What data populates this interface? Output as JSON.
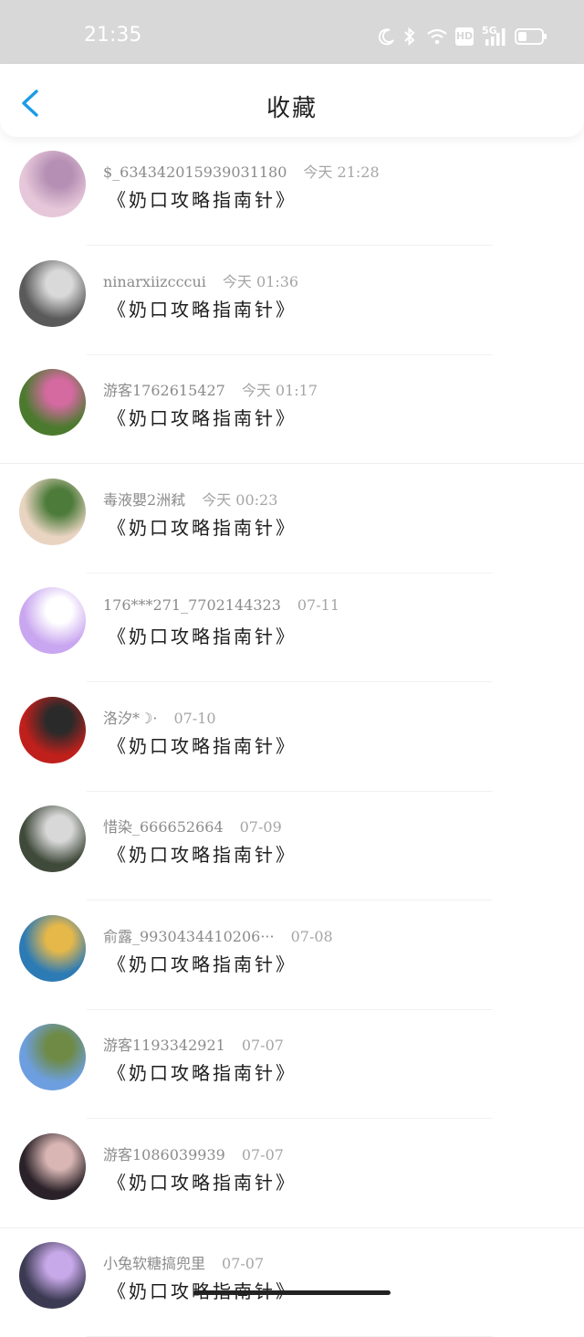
{
  "status_bar": {
    "time": "21:35",
    "badges": {
      "hd": "HD",
      "net": "5G"
    }
  },
  "header": {
    "title": "收藏",
    "back_icon": "chevron-left-icon",
    "accent": "#1a9be8"
  },
  "items": [
    {
      "user": "$_634342015939031180",
      "date": "今天 21:28",
      "title": "《奶口攻略指南针》",
      "avatar": [
        "#e6c7d9",
        "#b58fb4"
      ]
    },
    {
      "user": "ninarxiizcccui",
      "date": "今天 01:36",
      "title": "《奶口攻略指南针》",
      "avatar": [
        "#5a5a5a",
        "#d9d9d9"
      ]
    },
    {
      "user": "游客1762615427",
      "date": "今天 01:17",
      "title": "《奶口攻略指南针》",
      "avatar": [
        "#4b7a2e",
        "#d46aa0"
      ]
    },
    {
      "user": "毒液嬰2洲弒",
      "date": "今天 00:23",
      "title": "《奶口攻略指南针》",
      "avatar": [
        "#e9d4c2",
        "#4c7b3a"
      ]
    },
    {
      "user": "176***271_7702144323",
      "date": "07-11",
      "title": "《奶口攻略指南针》",
      "avatar": [
        "#c9a6f0",
        "#ffffff"
      ]
    },
    {
      "user": "洛汐*☽·",
      "date": "07-10",
      "title": "《奶口攻略指南针》",
      "avatar": [
        "#c0201c",
        "#2a2a2a"
      ]
    },
    {
      "user": "惜染_666652664",
      "date": "07-09",
      "title": "《奶口攻略指南针》",
      "avatar": [
        "#404a3b",
        "#d8d8d8"
      ]
    },
    {
      "user": "俞露_9930434410206···",
      "date": "07-08",
      "title": "《奶口攻略指南针》",
      "avatar": [
        "#2d7bb5",
        "#e6b84a"
      ]
    },
    {
      "user": "游客1193342921",
      "date": "07-07",
      "title": "《奶口攻略指南针》",
      "avatar": [
        "#6d9fe0",
        "#6e8a45"
      ]
    },
    {
      "user": "游客1086039939",
      "date": "07-07",
      "title": "《奶口攻略指南针》",
      "avatar": [
        "#2a2228",
        "#d9b6b4"
      ]
    },
    {
      "user": "小兔软糖搞兜里",
      "date": "07-07",
      "title": "《奶口攻略指南针》",
      "avatar": [
        "#3b3a52",
        "#c7a8e8"
      ]
    }
  ]
}
